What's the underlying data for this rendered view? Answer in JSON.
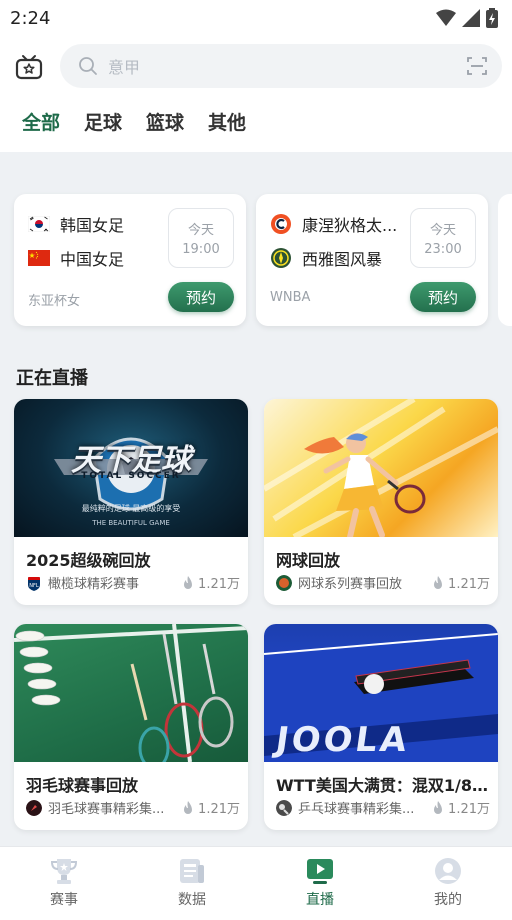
{
  "status_bar": {
    "time": "2:24"
  },
  "search": {
    "placeholder": "意甲"
  },
  "tabs": [
    {
      "label": "全部",
      "active": true
    },
    {
      "label": "足球",
      "active": false
    },
    {
      "label": "篮球",
      "active": false
    },
    {
      "label": "其他",
      "active": false
    }
  ],
  "matches": [
    {
      "home": "韩国女足",
      "away": "中国女足",
      "day": "今天",
      "time": "19:00",
      "league": "东亚杯女",
      "button": "预约"
    },
    {
      "home": "康涅狄格太...",
      "away": "西雅图风暴",
      "day": "今天",
      "time": "23:00",
      "league": "WNBA",
      "button": "预约"
    }
  ],
  "live": {
    "title": "正在直播",
    "cards": [
      {
        "title": "2025超级碗回放",
        "channel": "橄榄球精彩赛事",
        "heat": "1.21万",
        "thumb_text_main": "天下足球",
        "thumb_text_sub": "TOTAL SOCCER",
        "thumb_caption1": "最纯粹的足球 最高级的享受",
        "thumb_caption2": "THE BEAUTIFUL GAME"
      },
      {
        "title": "网球回放",
        "channel": "网球系列赛事回放",
        "heat": "1.21万"
      },
      {
        "title": "羽毛球赛事回放",
        "channel": "羽毛球赛事精彩集...",
        "heat": "1.21万"
      },
      {
        "title": "WTT美国大满贯：混双1/8...",
        "channel": "乒乓球赛事精彩集...",
        "heat": "1.21万",
        "thumb_brand": "JOOLA"
      }
    ]
  },
  "nav": [
    {
      "label": "赛事",
      "icon": "trophy-icon"
    },
    {
      "label": "数据",
      "icon": "news-icon"
    },
    {
      "label": "直播",
      "icon": "play-tv-icon",
      "active": true
    },
    {
      "label": "我的",
      "icon": "user-icon"
    }
  ],
  "colors": {
    "accent": "#1f6b4a",
    "button": "#2e8a5e",
    "background": "#eef1f4"
  }
}
